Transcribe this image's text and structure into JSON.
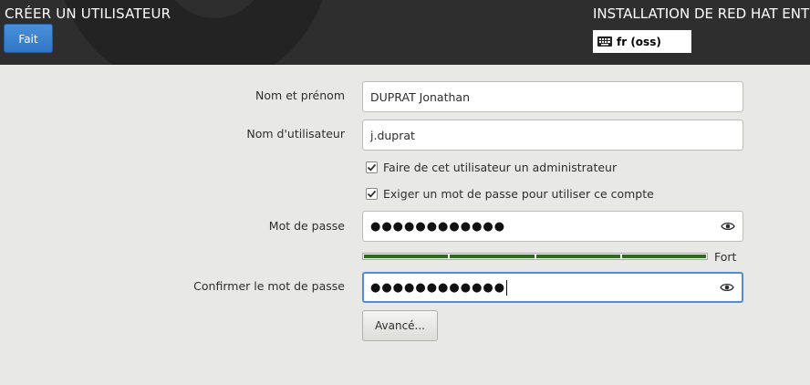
{
  "header": {
    "title": "CRÉER UN UTILISATEUR",
    "done_label": "Fait",
    "product_title": "INSTALLATION DE RED HAT ENTE",
    "keyboard_layout": "fr (oss)",
    "keyboard_icon": "keyboard-icon"
  },
  "form": {
    "fullname": {
      "label": "Nom et prénom",
      "value": "DUPRAT Jonathan"
    },
    "username": {
      "label": "Nom d'utilisateur",
      "value": "j.duprat"
    },
    "admin_checkbox": {
      "label": "Faire de cet utilisateur un administrateur",
      "checked": true
    },
    "require_password_checkbox": {
      "label": "Exiger un mot de passe pour utiliser ce compte",
      "checked": true
    },
    "password": {
      "label": "Mot de passe",
      "masked_value": "●●●●●●●●●●●●",
      "reveal_icon": "eye-icon"
    },
    "strength": {
      "label": "Fort",
      "level": 1.0,
      "segments": 4,
      "color": "#2b6e1a"
    },
    "confirm_password": {
      "label": "Confirmer le mot de passe",
      "masked_value": "●●●●●●●●●●●●",
      "reveal_icon": "eye-icon"
    },
    "advanced_label": "Avancé..."
  },
  "colors": {
    "header_bg": "#2e2e2e",
    "accent": "#4a90d9",
    "page_bg": "#e8e8e7"
  }
}
